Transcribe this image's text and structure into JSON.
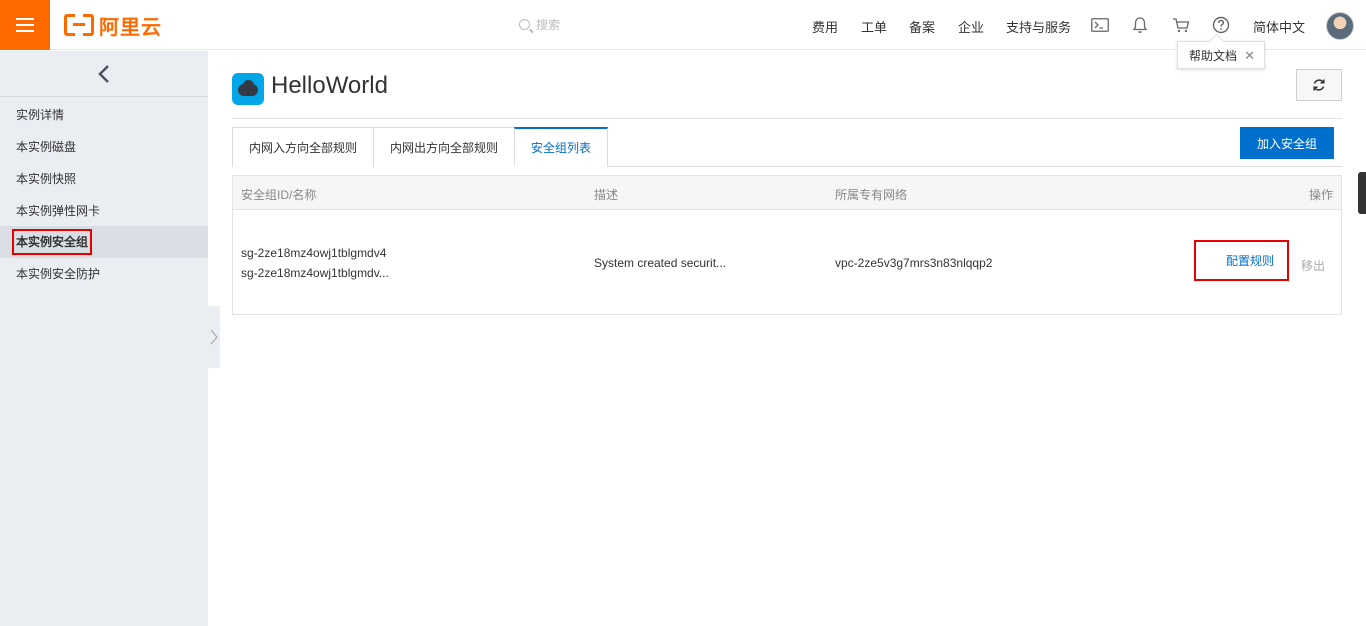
{
  "brand": {
    "name": "阿里云",
    "accent": "#ff6a00"
  },
  "search": {
    "placeholder": "搜索"
  },
  "nav": {
    "items": [
      "费用",
      "工单",
      "备案",
      "企业",
      "支持与服务"
    ],
    "language": "简体中文"
  },
  "tooltip": {
    "text": "帮助文档",
    "close": "✕"
  },
  "sidebar": {
    "items": [
      {
        "label": "实例详情"
      },
      {
        "label": "本实例磁盘"
      },
      {
        "label": "本实例快照"
      },
      {
        "label": "本实例弹性网卡"
      },
      {
        "label": "本实例安全组",
        "active": true
      },
      {
        "label": "本实例安全防护"
      }
    ]
  },
  "page": {
    "title": "HelloWorld"
  },
  "tabs": [
    {
      "label": "内网入方向全部规则"
    },
    {
      "label": "内网出方向全部规则"
    },
    {
      "label": "安全组列表",
      "active": true
    }
  ],
  "actions": {
    "add_security_group": "加入安全组"
  },
  "table": {
    "headers": {
      "id_name": "安全组ID/名称",
      "description": "描述",
      "vpc": "所属专有网络",
      "operations": "操作"
    },
    "rows": [
      {
        "id": "sg-2ze18mz4owj1tblgmdv4",
        "name": "sg-2ze18mz4owj1tblgmdv...",
        "description": "System created securit...",
        "vpc": "vpc-2ze5v3g7mrs3n83nlqqp2",
        "config_action": "配置规则",
        "remove_action": "移出"
      }
    ]
  },
  "colors": {
    "primary": "#0070cc",
    "highlight": "#e60000"
  }
}
